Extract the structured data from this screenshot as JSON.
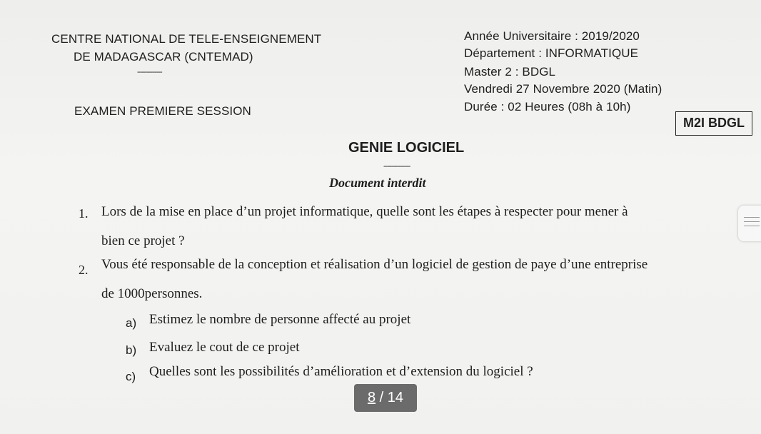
{
  "header_left": {
    "institution_line1": "CENTRE NATIONAL DE TELE-ENSEIGNEMENT",
    "institution_line2": "DE MADAGASCAR (CNTEMAD)",
    "divider": "-------------",
    "exam_session": "EXAMEN PREMIERE SESSION"
  },
  "header_right": {
    "academic_year": "Année Universitaire : 2019/2020",
    "department": "Département : INFORMATIQUE",
    "program": "Master 2 : BDGL",
    "date": "Vendredi  27 Novembre 2020 (Matin)",
    "duration": "Durée : 02 Heures (08h à 10h)"
  },
  "exam_code": "M2I BDGL",
  "title": "GENIE LOGICIEL",
  "title_divider": "--------------",
  "subtitle": "Document interdit",
  "questions": [
    {
      "number": "1.",
      "line1": "Lors de la mise en place d’un projet informatique, quelle sont les étapes à respecter pour mener à",
      "line2": "bien ce projet ?"
    },
    {
      "number": "2.",
      "line1": "Vous été responsable de la conception et réalisation d’un logiciel de gestion de paye  d’une entreprise",
      "line2": "de 1000personnes.",
      "sub": [
        {
          "letter": "a)",
          "text": "Estimez le nombre de personne affecté au projet"
        },
        {
          "letter": "b)",
          "text": "Evaluez le cout de ce projet"
        },
        {
          "letter": "c)",
          "text": "Quelles sont les possibilités d’amélioration et d’extension du logiciel ?"
        }
      ]
    }
  ],
  "viewer": {
    "current_page": "8",
    "separator": " / ",
    "total_pages": "14",
    "scroll_icon": "hamburger-icon"
  }
}
